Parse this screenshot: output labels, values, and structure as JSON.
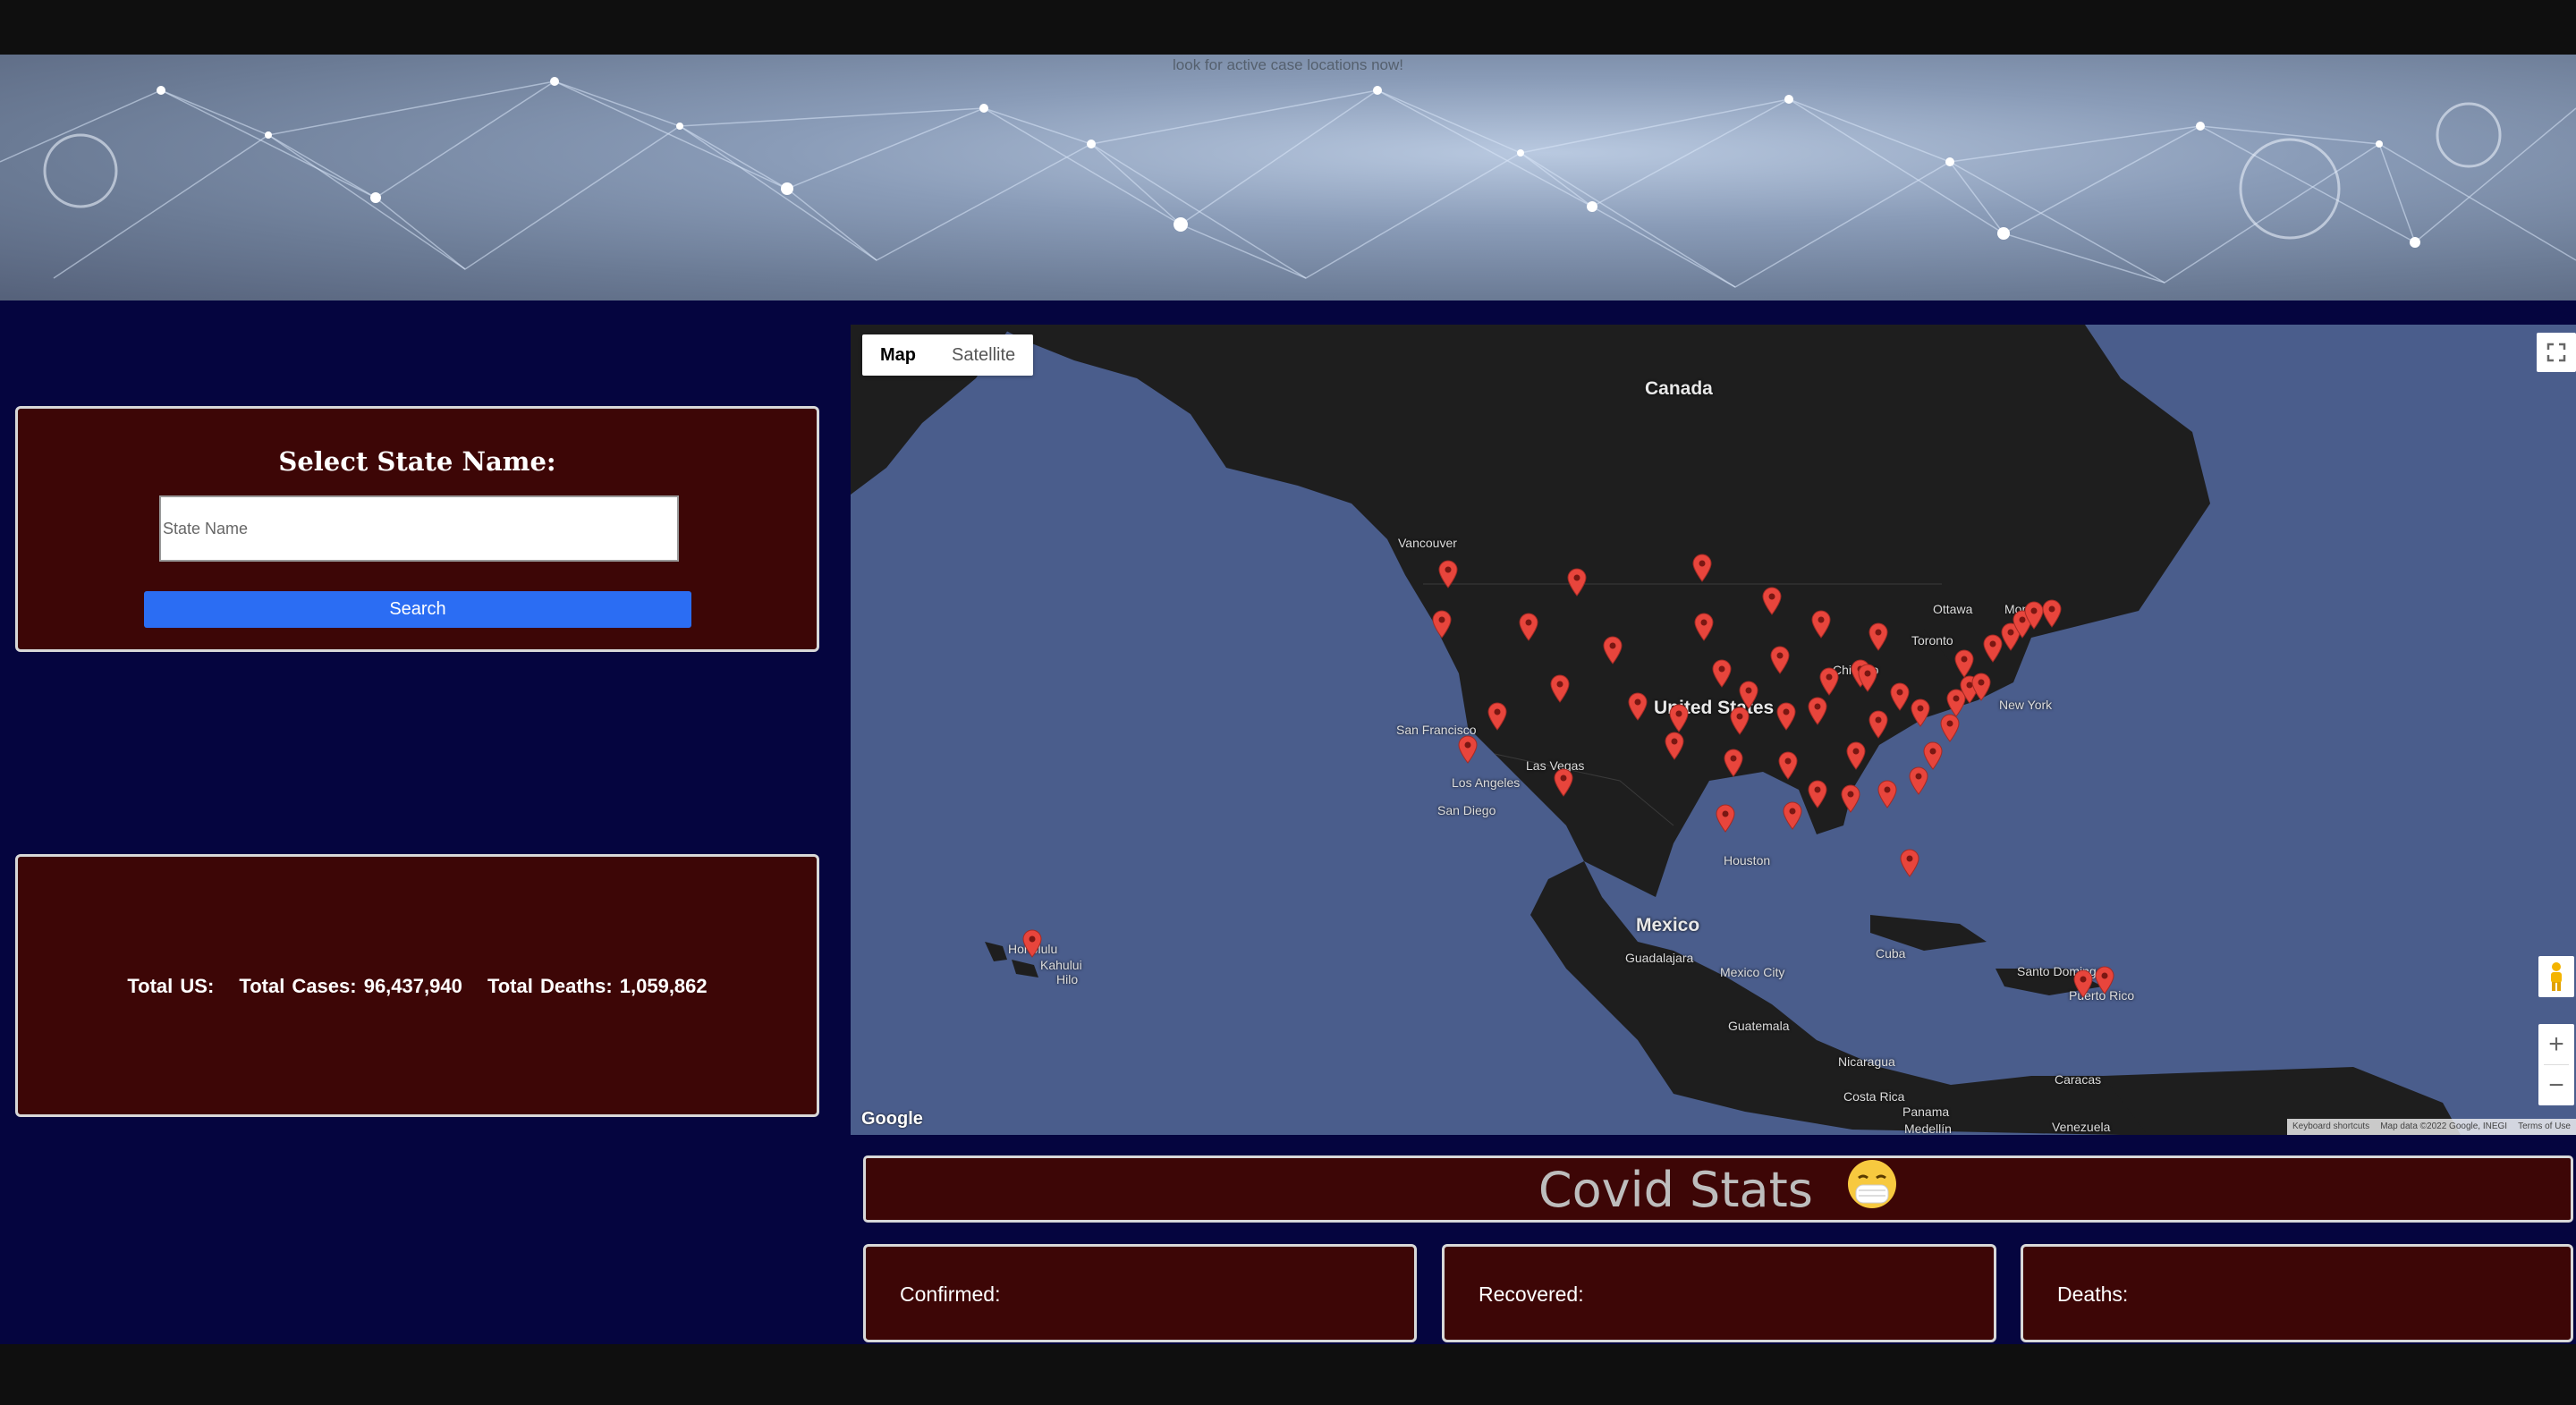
{
  "hero": {
    "tagline": "look for active case locations now!"
  },
  "select_panel": {
    "title": "Select State Name:",
    "input_placeholder": "State Name",
    "input_value": "",
    "search_label": "Search"
  },
  "totals": {
    "label": "Total US:",
    "cases": "Total Cases: 96,437,940",
    "deaths": "Total Deaths: 1,059,862"
  },
  "map": {
    "type_control": {
      "map_label": "Map",
      "satellite_label": "Satellite",
      "active": "Map"
    },
    "labels": {
      "canada": "Canada",
      "united_states": "United States",
      "mexico": "Mexico",
      "cuba": "Cuba",
      "guatemala": "Guatemala",
      "nicaragua": "Nicaragua",
      "costa_rica": "Costa Rica",
      "panama": "Panama",
      "caracas": "Caracas",
      "venezuela": "Venezuela",
      "medellin": "Medellín",
      "santo_domingo": "Santo Domingo",
      "puerto_rico": "Puerto Rico",
      "vancouver": "Vancouver",
      "san_francisco": "San Francisco",
      "los_angeles": "Los Angeles",
      "san_diego": "San Diego",
      "las_vegas": "Las Vegas",
      "houston": "Houston",
      "ottawa": "Ottawa",
      "toronto": "Toronto",
      "montreal": "Montreal",
      "new_york": "New York",
      "chicago": "Chicago",
      "guadalajara": "Guadalajara",
      "mexico_city": "Mexico City",
      "honolulu": "Honolulu",
      "kahului": "Kahului",
      "hilo": "Hilo"
    },
    "pin_count": 53,
    "google_logo": "Google",
    "attribution": {
      "shortcuts": "Keyboard shortcuts",
      "data": "Map data ©2022 Google, INEGI",
      "terms": "Terms of Use"
    }
  },
  "stats": {
    "title": "Covid Stats",
    "confirmed_label": "Confirmed:",
    "recovered_label": "Recovered:",
    "deaths_label": "Deaths:"
  },
  "colors": {
    "panel_bg": "#3d0606",
    "page_bg": "#05053f",
    "search_button": "#2b6df3",
    "pin": "#e8453c"
  }
}
